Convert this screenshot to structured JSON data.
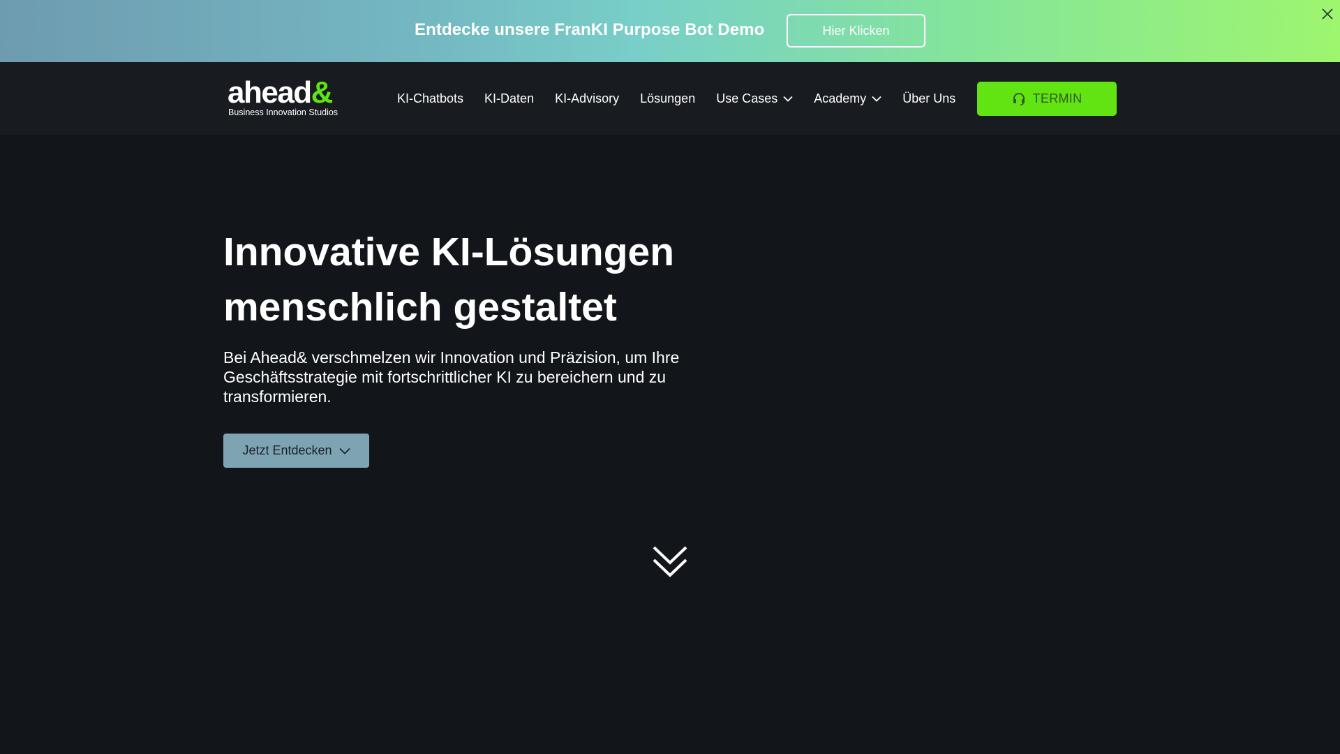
{
  "promo": {
    "text": "Entdecke unsere FranKI Purpose Bot Demo",
    "button_label": "Hier Klicken",
    "close_icon": "close-icon"
  },
  "nav": {
    "logo_word": "ahead",
    "logo_amp": "&",
    "logo_subtitle": "Business Innovation Studios",
    "items": [
      {
        "label": "KI-Chatbots",
        "has_dropdown": false
      },
      {
        "label": "KI-Daten",
        "has_dropdown": false
      },
      {
        "label": "KI-Advisory",
        "has_dropdown": false
      },
      {
        "label": "Lösungen",
        "has_dropdown": false
      },
      {
        "label": "Use Cases",
        "has_dropdown": true
      },
      {
        "label": "Academy",
        "has_dropdown": true
      },
      {
        "label": "Über Uns",
        "has_dropdown": false
      }
    ],
    "cta_label": "TERMIN",
    "cta_icon": "headset-icon"
  },
  "hero": {
    "title_line1": "Innovative KI-Lösungen",
    "title_line2": "menschlich gestaltet",
    "description": "Bei Ahead& verschmelzen wir Innovation und Präzision, um Ihre Geschäftsstrategie mit fortschrittlicher KI zu bereichern und zu transformieren.",
    "button_label": "Jetzt Entdecken",
    "scroll_icon": "double-chevron-down-icon"
  },
  "colors": {
    "page_background": "#12161b",
    "nav_background": "#181b20",
    "accent_green": "#62e312",
    "hero_button": "#7ea4b4"
  }
}
